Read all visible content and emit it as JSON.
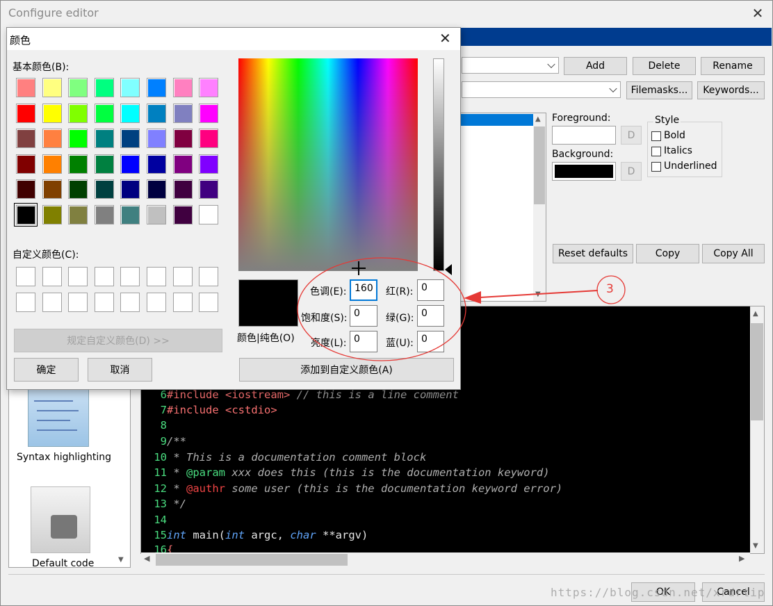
{
  "main_window": {
    "title": "Configure editor",
    "buttons": {
      "add": "Add",
      "delete": "Delete",
      "rename": "Rename",
      "filemasks": "Filemasks...",
      "keywords": "Keywords..."
    },
    "foreground_label": "Foreground:",
    "background_label": "Background:",
    "d_label": "D",
    "style": {
      "title": "Style",
      "bold": "Bold",
      "italics": "Italics",
      "underlined": "Underlined"
    },
    "reset_defaults": "Reset defaults",
    "copy": "Copy",
    "copy_all": "Copy All",
    "ok": "OK",
    "cancel": "Cancel",
    "sidebar": {
      "syntax_highlighting": "Syntax highlighting",
      "default_code": "Default code"
    },
    "colors": {
      "foreground_swatch": "#ffffff",
      "background_swatch": "#000000",
      "title_bar": "#003c8f",
      "selection": "#0078d7"
    }
  },
  "code": {
    "lines": [
      {
        "n": "6",
        "pp": "#include",
        "inc": "<iostream>",
        "comment": "// this is a line comment"
      },
      {
        "n": "7",
        "pp": "#include",
        "inc": "<cstdio>"
      },
      {
        "n": "8"
      },
      {
        "n": "9",
        "doc_open": "/**"
      },
      {
        "n": "10",
        "doc": " * This is a documentation comment block"
      },
      {
        "n": "11",
        "doc_star": " * ",
        "tag": "@param",
        "doc_rest": " xxx does this (this is the documentation keyword)"
      },
      {
        "n": "12",
        "doc_star": " * ",
        "tag_err": "@authr",
        "doc_rest": " some user (this is the documentation keyword error)"
      },
      {
        "n": "13",
        "doc_close": " */"
      },
      {
        "n": "14"
      },
      {
        "n": "15",
        "kw1": "int",
        "t1": " main(",
        "kw2": "int",
        "t2": " argc, ",
        "kw3": "char",
        "t3": " **argv)"
      },
      {
        "n": "16",
        "t1": "{"
      }
    ]
  },
  "color_dialog": {
    "title": "颜色",
    "basic_colors_label": "基本颜色(B):",
    "custom_colors_label": "自定义颜色(C):",
    "define_custom": "规定自定义颜色(D) >>",
    "ok": "确定",
    "cancel": "取消",
    "solid_label": "颜色|纯色(O)",
    "add_custom": "添加到自定义颜色(A)",
    "fields": {
      "hue": {
        "label": "色调(E):",
        "value": "160"
      },
      "sat": {
        "label": "饱和度(S):",
        "value": "0"
      },
      "lum": {
        "label": "亮度(L):",
        "value": "0"
      },
      "red": {
        "label": "红(R):",
        "value": "0"
      },
      "green": {
        "label": "绿(G):",
        "value": "0"
      },
      "blue": {
        "label": "蓝(U):",
        "value": "0"
      }
    },
    "basic_colors": [
      "#ff8080",
      "#ffff80",
      "#80ff80",
      "#00ff80",
      "#80ffff",
      "#0080ff",
      "#ff80c0",
      "#ff80ff",
      "#ff0000",
      "#ffff00",
      "#80ff00",
      "#00ff40",
      "#00ffff",
      "#0080c0",
      "#8080c0",
      "#ff00ff",
      "#804040",
      "#ff8040",
      "#00ff00",
      "#008080",
      "#004080",
      "#8080ff",
      "#800040",
      "#ff0080",
      "#800000",
      "#ff8000",
      "#008000",
      "#008040",
      "#0000ff",
      "#0000a0",
      "#800080",
      "#8000ff",
      "#400000",
      "#804000",
      "#004000",
      "#004040",
      "#000080",
      "#000040",
      "#400040",
      "#400080",
      "#000000",
      "#808000",
      "#808040",
      "#808080",
      "#408080",
      "#c0c0c0",
      "#400040",
      "#ffffff"
    ],
    "custom_color_count": 16,
    "selected_color": "#000000"
  },
  "annotation": {
    "label": "3",
    "color": "#e53935"
  },
  "watermark": "https://blog.csdn.net/xrdrtip"
}
